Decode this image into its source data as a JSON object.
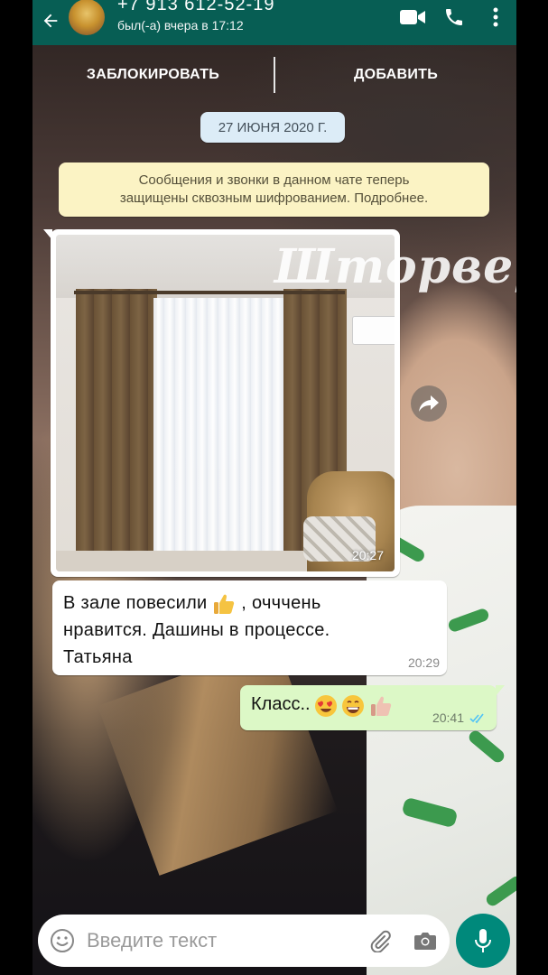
{
  "header": {
    "back_icon": "arrow-back-icon",
    "phone": "+7 913 612-52-19",
    "last_seen": "был(-а) вчера в 17:12",
    "icons": [
      "video-call-icon",
      "phone-call-icon",
      "more-vert-icon"
    ]
  },
  "actions": {
    "block_label": "ЗАБЛОКИРОВАТЬ",
    "add_label": "ДОБАВИТЬ"
  },
  "date_chip": "27 ИЮНЯ 2020 Г.",
  "encryption_notice": {
    "line1": "Сообщения и звонки в данном чате теперь",
    "line2": "защищены сквозным шифрованием. Подробнее."
  },
  "messages": {
    "image": {
      "time": "20:27",
      "watermark": "Шторвери"
    },
    "incoming": {
      "part1": "В зале повесили",
      "part2": ", очччень",
      "line2": "нравится. Дашины в процессе.",
      "line3": "Татьяна",
      "time": "20:29",
      "emoji": "thumbs-up"
    },
    "outgoing": {
      "text": "Класс..",
      "emojis": [
        "heart-eyes",
        "grinning",
        "thumbs-up"
      ],
      "time": "20:41",
      "status": "read"
    }
  },
  "composer": {
    "placeholder": "Введите текст",
    "icons": [
      "emoji-icon",
      "attach-icon",
      "camera-icon",
      "mic-icon"
    ]
  },
  "colors": {
    "header": "#075e54",
    "outgoing_bubble": "#dcf8c6",
    "notice": "#fbf3c4",
    "date_chip": "#dcecf7",
    "mic_button": "#00897b",
    "read_ticks": "#4fc3f7"
  }
}
